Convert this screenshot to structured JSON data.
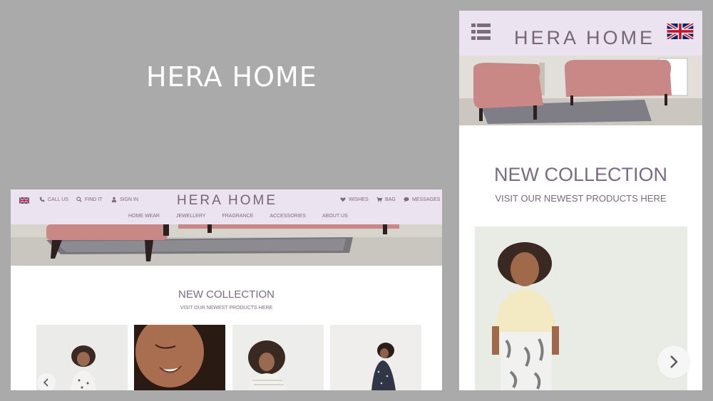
{
  "hero": {
    "title": "HERA HOME"
  },
  "desktop": {
    "logo": "HERA HOME",
    "utility_left": [
      {
        "icon": "phone-icon",
        "label": "CALL US"
      },
      {
        "icon": "search-icon",
        "label": "FIND IT"
      },
      {
        "icon": "user-icon",
        "label": "SIGN IN"
      }
    ],
    "utility_right": [
      {
        "icon": "heart-icon",
        "label": "WISHES"
      },
      {
        "icon": "cart-icon",
        "label": "BAG"
      },
      {
        "icon": "chat-icon",
        "label": "MESSAGES"
      }
    ],
    "nav": [
      "HOME WEAR",
      "JEWELLERY",
      "FRAGRANCE",
      "ACCESSORIES",
      "ABOUT US"
    ],
    "section": {
      "title": "NEW COLLECTION",
      "subtitle": "VISIT OUR NEWEST PRODUCTS HERE"
    }
  },
  "mobile": {
    "logo": "HERA HOME",
    "section": {
      "title": "NEW COLLECTION",
      "subtitle": "VISIT OUR NEWEST PRODUCTS HERE"
    }
  },
  "colors": {
    "header_bg": "#ebe3ef",
    "brand_text": "#766578",
    "page_bg": "#aaaaaa",
    "sofa": "#c98886"
  }
}
